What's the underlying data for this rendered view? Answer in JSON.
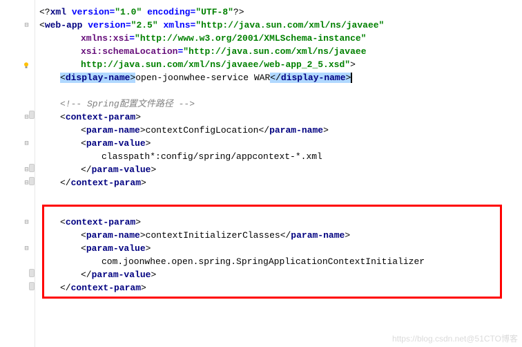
{
  "xml_decl": {
    "version_attr": "version",
    "version_val": "\"1.0\"",
    "encoding_attr": "encoding",
    "encoding_val": "\"UTF-8\""
  },
  "webapp": {
    "tag": "web-app",
    "version_attr": "version",
    "version_val": "\"2.5\"",
    "xmlns_attr": "xmlns",
    "xmlns_val": "\"http://java.sun.com/xml/ns/javaee\"",
    "xmlns_xsi_attr": "xmlns:xsi",
    "xmlns_xsi_val": "\"http://www.w3.org/2001/XMLSchema-instance\"",
    "xsi_loc_attr": "xsi:schemaLocation",
    "xsi_loc_val1": "\"http://java.sun.com/xml/ns/javaee",
    "xsi_loc_val2": "http://java.sun.com/xml/ns/javaee/web-app_2_5.xsd\""
  },
  "display_name": {
    "tag": "display-name",
    "text": "open-joonwhee-service WAR"
  },
  "comment": "<!-- Spring配置文件路径 -->",
  "context_param1": {
    "tag": "context-param",
    "param_name_tag": "param-name",
    "param_name_text": "contextConfigLocation",
    "param_value_tag": "param-value",
    "param_value_text": "classpath*:config/spring/appcontext-*.xml"
  },
  "context_param2": {
    "tag": "context-param",
    "param_name_tag": "param-name",
    "param_name_text": "contextInitializerClasses",
    "param_value_tag": "param-value",
    "param_value_text": "com.joonwhee.open.spring.SpringApplicationContextInitializer"
  },
  "watermark": "https://blog.csdn.net@51CTO博客"
}
